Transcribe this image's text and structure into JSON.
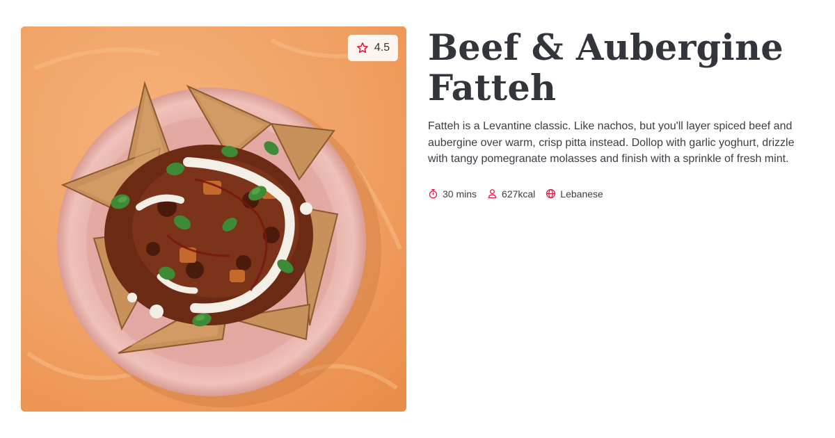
{
  "recipe": {
    "title": "Beef & Aubergine Fatteh",
    "description": "Fatteh is a Levantine classic. Like nachos, but you'll layer spiced beef and aubergine over warm, crisp pitta instead. Dollop with garlic yoghurt, drizzle with tangy pomegranate molasses and finish with a sprinkle of fresh mint.",
    "rating": "4.5",
    "rating_icon": "star-outline-icon",
    "meta": [
      {
        "icon": "timer-icon",
        "label": "30 mins"
      },
      {
        "icon": "person-icon",
        "label": "627kcal"
      },
      {
        "icon": "globe-icon",
        "label": "Lebanese"
      }
    ]
  },
  "colors": {
    "accent": "#e0103a",
    "title": "#33353c",
    "body_text": "#3b3d44",
    "background_orange": "#f0a060",
    "plate_pink": "#eab7b0"
  }
}
